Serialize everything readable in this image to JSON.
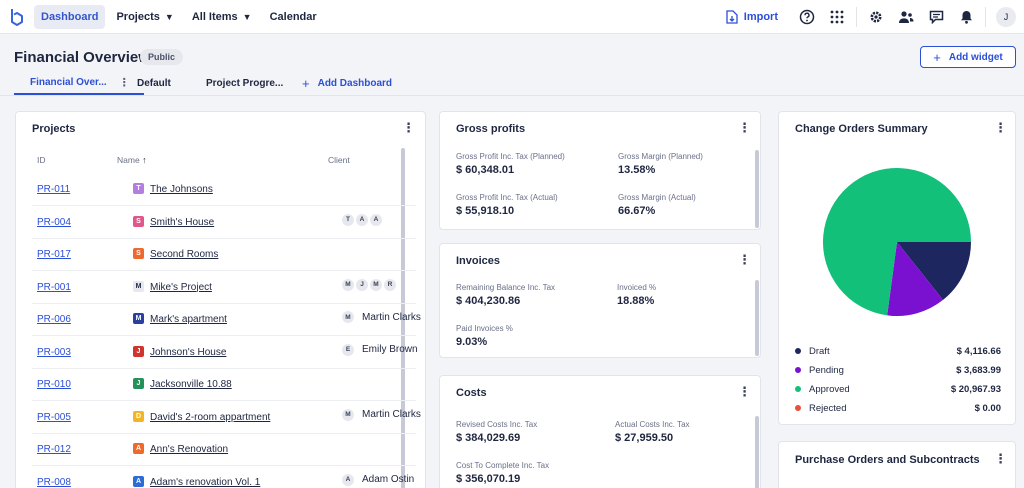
{
  "nav": {
    "items": [
      {
        "label": "Dashboard",
        "active": true,
        "dropdown": false
      },
      {
        "label": "Projects",
        "active": false,
        "dropdown": true
      },
      {
        "label": "All Items",
        "active": false,
        "dropdown": true
      },
      {
        "label": "Calendar",
        "active": false,
        "dropdown": false
      }
    ],
    "import_label": "Import",
    "avatar_initial": "J"
  },
  "header": {
    "title": "Financial Overview",
    "badge": "Public",
    "add_widget_label": "Add widget"
  },
  "dashboard_tabs": {
    "items": [
      {
        "label": "Financial Over...",
        "active": true
      },
      {
        "label": "Default",
        "active": false
      },
      {
        "label": "Project Progre...",
        "active": false
      }
    ],
    "add_label": "Add Dashboard"
  },
  "projects": {
    "title": "Projects",
    "columns": {
      "id": "ID",
      "name": "Name",
      "client": "Client"
    },
    "rows": [
      {
        "id": "PR-011",
        "initial": "T",
        "color": "#b47ee0",
        "name": "The Johnsons",
        "avatars": [],
        "client": ""
      },
      {
        "id": "PR-004",
        "initial": "S",
        "color": "#e0578a",
        "name": "Smith's House",
        "avatars": [
          "T",
          "A",
          "A"
        ],
        "client": ""
      },
      {
        "id": "PR-017",
        "initial": "S",
        "color": "#ee6a2c",
        "name": "Second Rooms",
        "avatars": [],
        "client": ""
      },
      {
        "id": "PR-001",
        "initial": "M",
        "color": "#e6e8ee",
        "name": "Mike's Project",
        "avatars": [
          "M",
          "J",
          "M",
          "R"
        ],
        "client": ""
      },
      {
        "id": "PR-006",
        "initial": "M",
        "color": "#2b3f9e",
        "name": "Mark's apartment",
        "avatars": [
          "M"
        ],
        "client": "Martin Clarks"
      },
      {
        "id": "PR-003",
        "initial": "J",
        "color": "#d1342f",
        "name": "Johnson's House",
        "avatars": [
          "E"
        ],
        "client": "Emily Brown"
      },
      {
        "id": "PR-010",
        "initial": "J",
        "color": "#24915a",
        "name": "Jacksonville 10.88",
        "avatars": [],
        "client": ""
      },
      {
        "id": "PR-005",
        "initial": "D",
        "color": "#f2b526",
        "name": "David's 2-room appartment",
        "avatars": [
          "M"
        ],
        "client": "Martin Clarks"
      },
      {
        "id": "PR-012",
        "initial": "A",
        "color": "#ee6a2c",
        "name": "Ann's Renovation",
        "avatars": [],
        "client": ""
      },
      {
        "id": "PR-008",
        "initial": "A",
        "color": "#2b6cd6",
        "name": "Adam's renovation Vol. 1",
        "avatars": [
          "A"
        ],
        "client": "Adam Ostin"
      }
    ]
  },
  "gross_profits": {
    "title": "Gross profits",
    "metrics": [
      {
        "label": "Gross Profit Inc. Tax (Planned)",
        "value": "$ 60,348.01"
      },
      {
        "label": "Gross Margin (Planned)",
        "value": "13.58%"
      },
      {
        "label": "Gross Profit Inc. Tax (Actual)",
        "value": "$ 55,918.10"
      },
      {
        "label": "Gross Margin (Actual)",
        "value": "66.67%"
      }
    ]
  },
  "invoices": {
    "title": "Invoices",
    "metrics": [
      {
        "label": "Remaining Balance Inc. Tax",
        "value": "$ 404,230.86"
      },
      {
        "label": "Invoiced %",
        "value": "18.88%"
      },
      {
        "label": "Paid Invoices %",
        "value": "9.03%"
      }
    ]
  },
  "costs": {
    "title": "Costs",
    "metrics": [
      {
        "label": "Revised Costs Inc. Tax",
        "value": "$ 384,029.69"
      },
      {
        "label": "Actual Costs Inc. Tax",
        "value": "$ 27,959.50"
      },
      {
        "label": "Cost To Complete Inc. Tax",
        "value": "$ 356,070.19"
      }
    ]
  },
  "change_orders": {
    "title": "Change Orders Summary",
    "legend": [
      {
        "label": "Draft",
        "value": "$ 4,116.66",
        "color": "#1e2660"
      },
      {
        "label": "Pending",
        "value": "$ 3,683.99",
        "color": "#7a10d0"
      },
      {
        "label": "Approved",
        "value": "$ 20,967.93",
        "color": "#12c07a"
      },
      {
        "label": "Rejected",
        "value": "$ 0.00",
        "color": "#e8503a"
      }
    ]
  },
  "chart_data": {
    "type": "pie",
    "categories": [
      "Draft",
      "Pending",
      "Approved",
      "Rejected"
    ],
    "values": [
      4116.66,
      3683.99,
      20967.93,
      0.0
    ],
    "colors": [
      "#1e2660",
      "#7a10d0",
      "#12c07a",
      "#e8503a"
    ],
    "title": "Change Orders Summary",
    "legend": "bottom"
  },
  "purchase_orders": {
    "title": "Purchase Orders and Subcontracts"
  }
}
